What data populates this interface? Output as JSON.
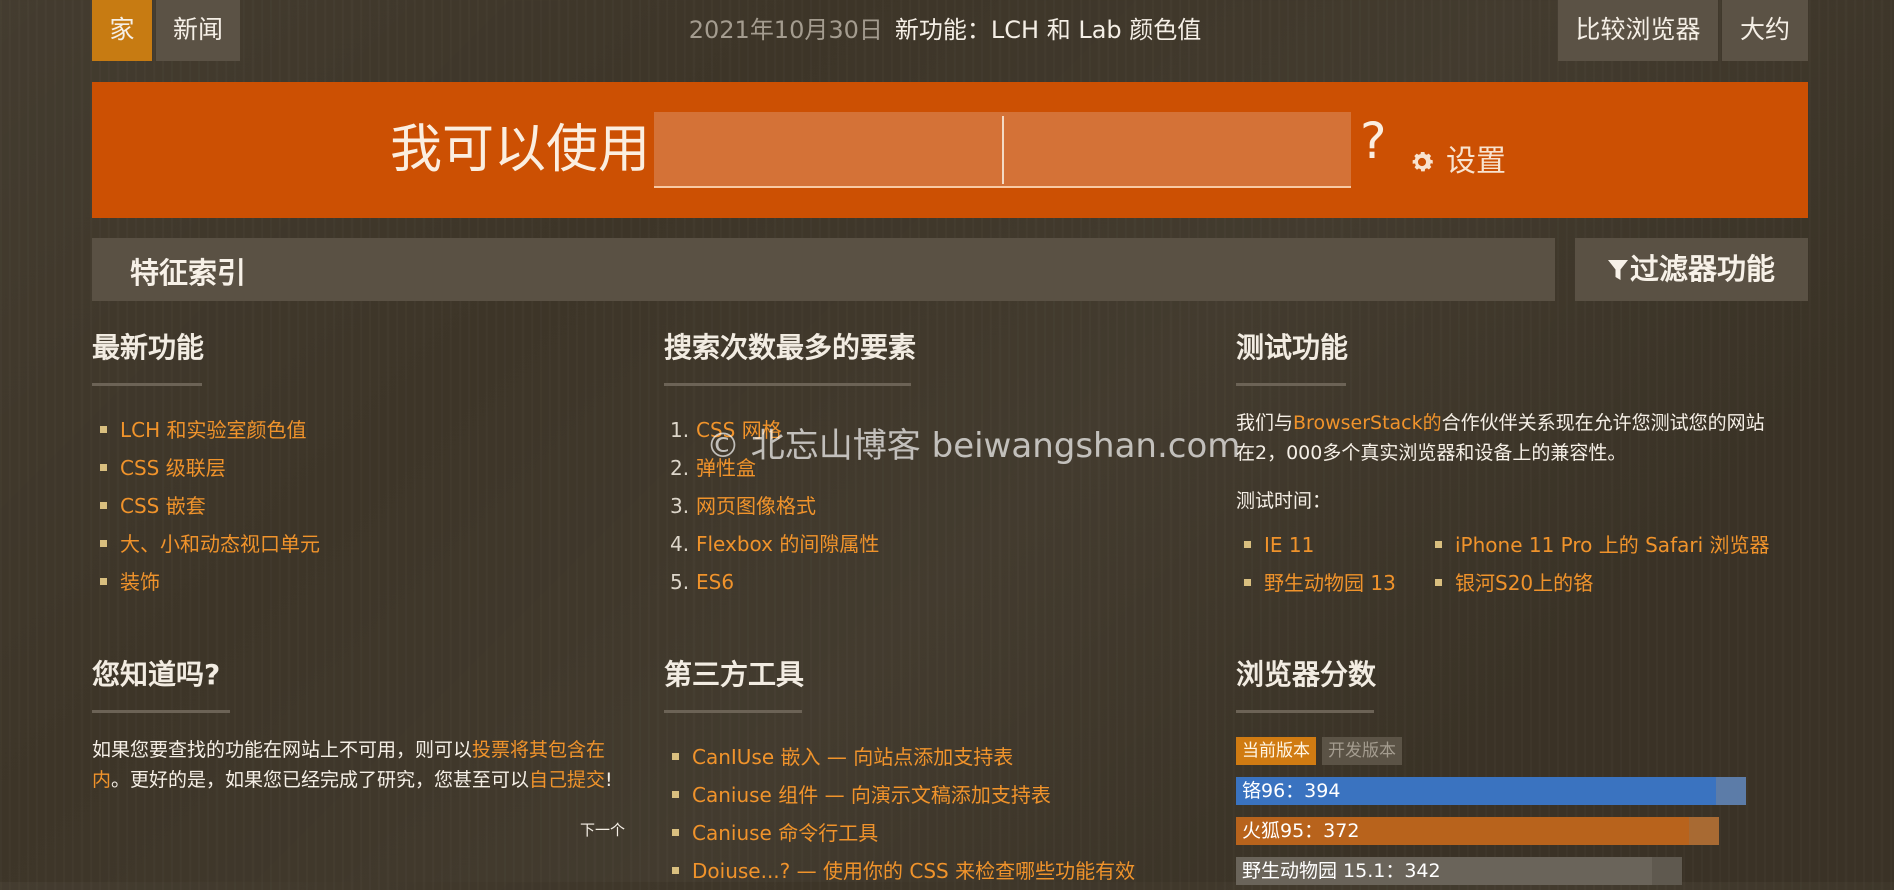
{
  "nav": {
    "home": "家",
    "news": "新闻",
    "date": "2021年10月30日",
    "announcement": "新功能：LCH 和 Lab 颜色值",
    "compare": "比较浏览器",
    "about": "大约"
  },
  "banner": {
    "title": "我可以使用",
    "question_mark": "?",
    "settings": "设置"
  },
  "index_bar": {
    "label": "特征索引",
    "filter": "过滤器功能"
  },
  "latest": {
    "heading": "最新功能",
    "items": [
      "LCH 和实验室颜色值",
      "CSS 级联层",
      "CSS 嵌套",
      "大、小和动态视口单元",
      "装饰"
    ]
  },
  "most_searched": {
    "heading": "搜索次数最多的要素",
    "items": [
      {
        "n": "1.",
        "label": "CSS 网格"
      },
      {
        "n": "2.",
        "label": "弹性盒"
      },
      {
        "n": "3.",
        "label": "网页图像格式"
      },
      {
        "n": "4.",
        "label": "Flexbox 的间隙属性"
      },
      {
        "n": "5.",
        "label": "ES6"
      }
    ]
  },
  "test": {
    "heading": "测试功能",
    "intro_pre": "我们与",
    "intro_link": "BrowserStack的",
    "intro_post": "合作伙伴关系现在允许您测试您的网站在2，000多个真实浏览器和设备上的兼容性。",
    "time_label": "测试时间：",
    "left_items": [
      "IE 11",
      "野生动物园 13"
    ],
    "right_items": [
      "iPhone 11 Pro 上的 Safari 浏览器",
      "银河S20上的铬"
    ]
  },
  "did_you_know": {
    "heading": "您知道吗?",
    "text_1": "如果您要查找的功能在网站上不可用，则可以",
    "link_1": "投票将其包含在内",
    "text_2": "。更好的是，如果您已经完成了研究，您甚至可以",
    "link_2": "自己提交",
    "text_3": "!",
    "next": "下一个"
  },
  "third_party": {
    "heading": "第三方工具",
    "items": [
      "CanIUse 嵌入 — 向站点添加支持表",
      "Caniuse 组件 — 向演示文稿添加支持表",
      "Caniuse 命令行工具",
      "Doiuse...? — 使用你的 CSS 来检查哪些功能有效"
    ]
  },
  "scores": {
    "heading": "浏览器分数",
    "tab_current": "当前版本",
    "tab_dev": "开发版本",
    "max": 394,
    "rows": [
      {
        "label": "铬96：394",
        "value": 394,
        "color": "#3a73c0",
        "bg": "#5c7ca8"
      },
      {
        "label": "火狐95：372",
        "value": 372,
        "color": "#b8631c",
        "bg": "#a86a33"
      },
      {
        "label": "野生动物园 15.1：342",
        "value": 342,
        "color": "#6a645a",
        "bg": "#5f594f"
      }
    ]
  },
  "watermark": "© 北忘山博客 beiwangshan.com",
  "colors": {
    "accent": "#f0932b",
    "banner": "#cc5003",
    "active_nav": "#c77b12"
  }
}
